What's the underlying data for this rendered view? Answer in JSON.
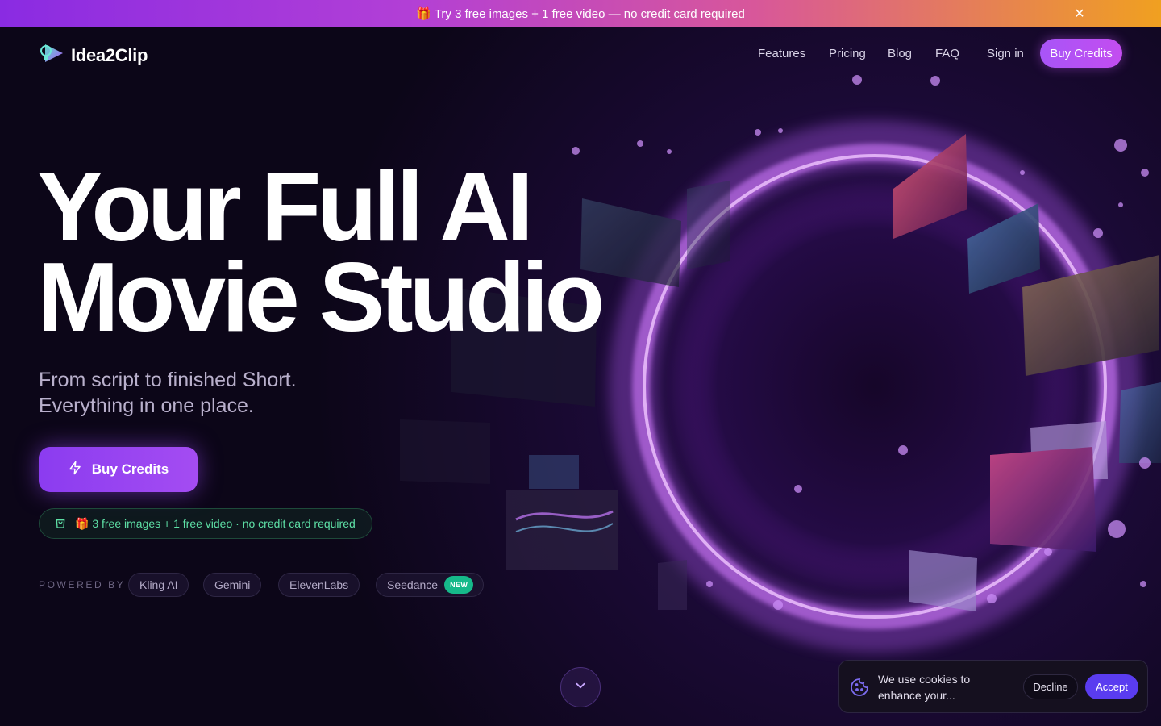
{
  "promo": {
    "gift_icon": "gift-icon",
    "text": "Try 3 free images + 1 free video — no credit card required",
    "close_icon": "close-icon"
  },
  "nav": {
    "logo_text": "Idea2Clip",
    "links": [
      "Features",
      "Pricing",
      "Blog",
      "FAQ"
    ],
    "sign_in": "Sign in",
    "buy_credits": "Buy Credits"
  },
  "hero": {
    "headline_line1": "Your Full AI",
    "headline_line2": "Movie Studio",
    "sub_line1": "From script to finished Short.",
    "sub_line2": "Everything in one place.",
    "cta_label": "Buy Credits",
    "cta_icon": "lightning-icon",
    "free_offer": "🎁 3 free images + 1 free video · no credit card required",
    "free_icon": "shopping-bag-icon",
    "powered_by_label": "POWERED BY",
    "providers": [
      "Kling AI",
      "Gemini",
      "ElevenLabs",
      "Seedance"
    ],
    "new_badge": "NEW",
    "scroll_icon": "chevron-down-icon"
  },
  "cookie": {
    "icon": "cookie-icon",
    "text": "We use cookies to enhance your...",
    "decline": "Decline",
    "accept": "Accept"
  },
  "colors": {
    "background": "#0c0618",
    "accent_purple": "#a855f7",
    "accent_green": "#5ee0a6",
    "accept_blue": "#5a3cf0"
  }
}
